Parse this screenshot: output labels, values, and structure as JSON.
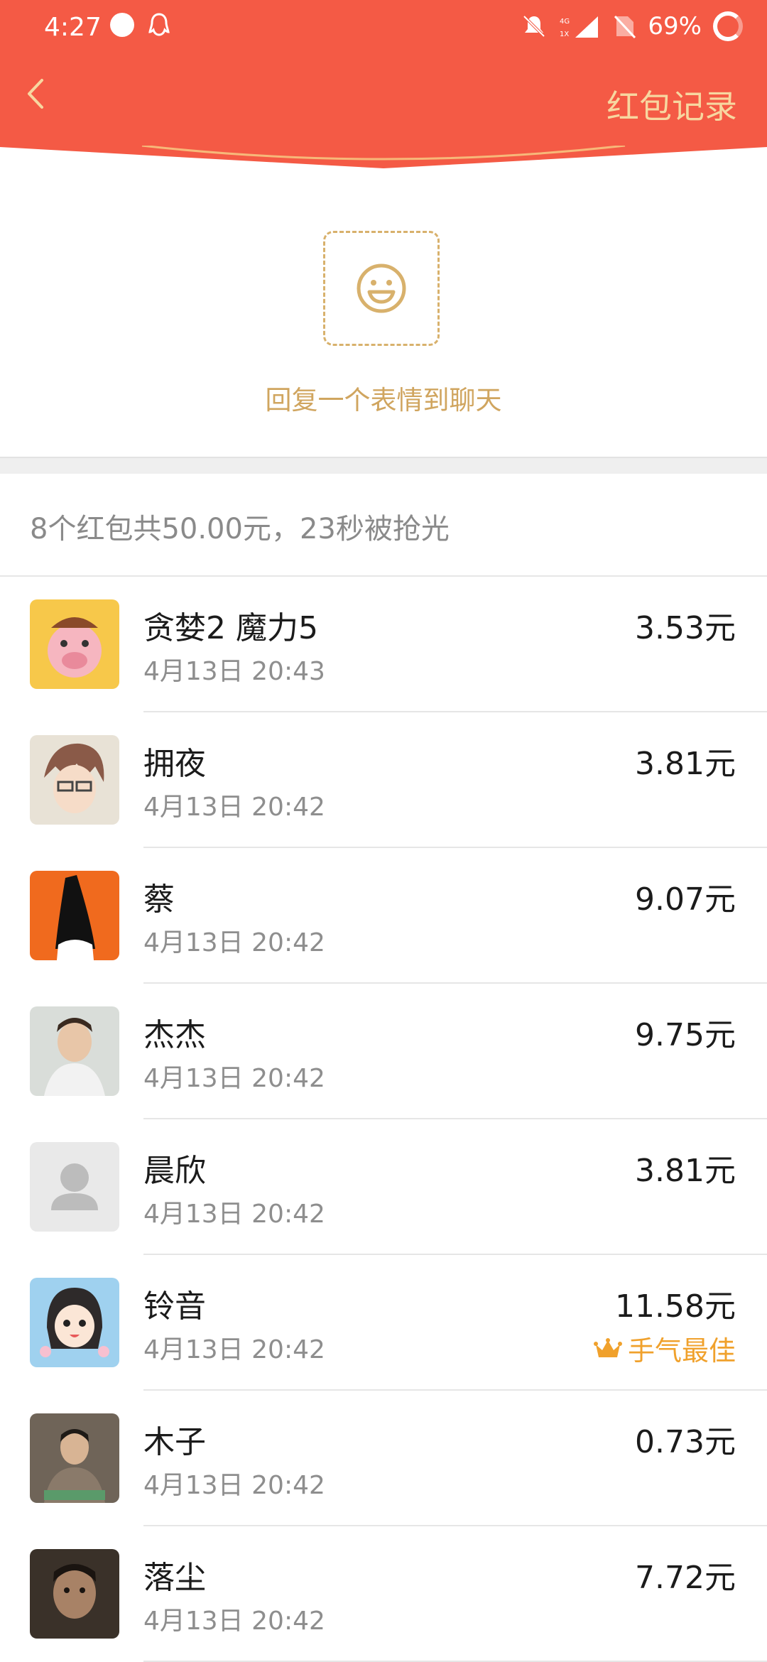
{
  "status_bar": {
    "time": "4:27",
    "battery": "69%",
    "network": "4G 1X"
  },
  "nav": {
    "title": "红包记录"
  },
  "emoji_prompt": {
    "hint": "回复一个表情到聊天"
  },
  "summary": {
    "text": "8个红包共50.00元，23秒被抢光"
  },
  "records": [
    {
      "name": "贪婪2  魔力5",
      "date": "4月13日  20:43",
      "amount": "3.53元",
      "avatar_color": "#f7c84a"
    },
    {
      "name": "拥夜",
      "date": "4月13日  20:42",
      "amount": "3.81元",
      "avatar_color": "#e8e2d6"
    },
    {
      "name": "蔡",
      "date": "4月13日  20:42",
      "amount": "9.07元",
      "avatar_color": "#f06a1e"
    },
    {
      "name": "杰杰",
      "date": "4月13日  20:42",
      "amount": "9.75元",
      "avatar_color": "#d9ddd9"
    },
    {
      "name": "晨欣",
      "date": "4月13日  20:42",
      "amount": "3.81元",
      "avatar_color": "#e9e9e9"
    },
    {
      "name": "铃音",
      "date": "4月13日  20:42",
      "amount": "11.58元",
      "best_label": "手气最佳",
      "avatar_color": "#9fd1ef"
    },
    {
      "name": "木子",
      "date": "4月13日  20:42",
      "amount": "0.73元",
      "avatar_color": "#6f6458"
    },
    {
      "name": "落尘",
      "date": "4月13日  20:42",
      "amount": "7.72元",
      "avatar_color": "#3a3129"
    }
  ],
  "colors": {
    "header_red": "#f45a45",
    "title_gold": "#f7d7a0",
    "hint_gold": "#d0a55f",
    "best_orange": "#f0a12c"
  }
}
